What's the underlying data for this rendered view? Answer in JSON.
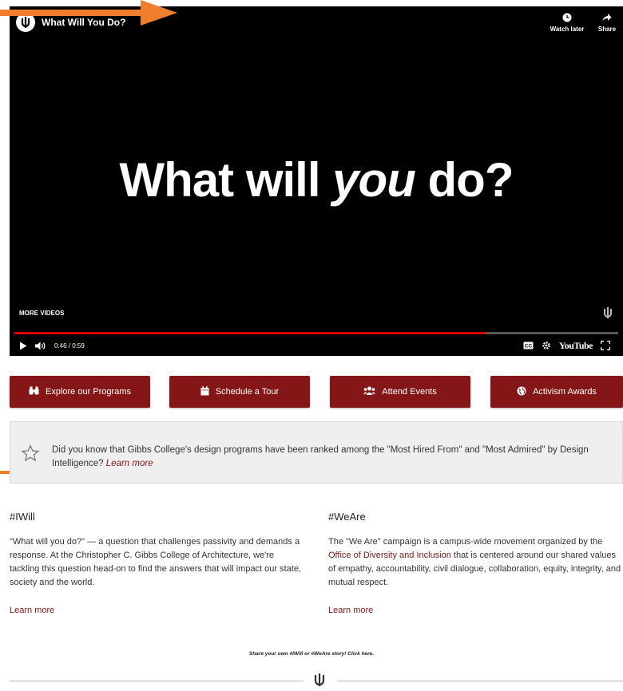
{
  "player": {
    "title": "What Will You Do?",
    "watch_later": "Watch later",
    "share": "Share",
    "headline_pre": "What will ",
    "headline_em": "you",
    "headline_post": " do?",
    "more_videos": "MORE VIDEOS",
    "time": "0:46 / 0:59",
    "progress": 0.78,
    "youtube": "YouTube"
  },
  "cta": [
    {
      "label": "Explore our Programs",
      "icon": "binoculars-icon",
      "glyph": "⌘"
    },
    {
      "label": "Schedule a Tour",
      "icon": "calendar-icon",
      "glyph": "▦"
    },
    {
      "label": "Attend Events",
      "icon": "users-icon",
      "glyph": "⚇"
    },
    {
      "label": "Activism Awards",
      "icon": "globe-icon",
      "glyph": "◍"
    }
  ],
  "callout": {
    "text": "Did you know that Gibbs College's design programs have been ranked among the \"Most Hired From\" and \"Most Admired\" by Design Intelligence?",
    "link": "Learn more"
  },
  "iwill": {
    "heading": "#IWill",
    "body": "\"What will you do?\" — a question that challenges passivity and demands a response. At the Christopher C. Gibbs College of Architecture, we're tackling this question head-on to find the answers that will impact our state, society and the world.",
    "link": "Learn more"
  },
  "weare": {
    "heading": "#WeAre",
    "body_pre": "The \"We Are\" campaign is a campus-wide movement organized by the ",
    "body_link": "Office of Diversity and Inclusion",
    "body_post": " that is centered around our shared values of empathy, accountability, civil dialogue, collaboration, equity, integrity, and mutual respect.",
    "link": "Learn more"
  },
  "share_line": "Share your own #IWill or #WeAre story! Click here.",
  "colors": {
    "crimson": "#841617",
    "annotation_orange": "#F07F2D"
  }
}
